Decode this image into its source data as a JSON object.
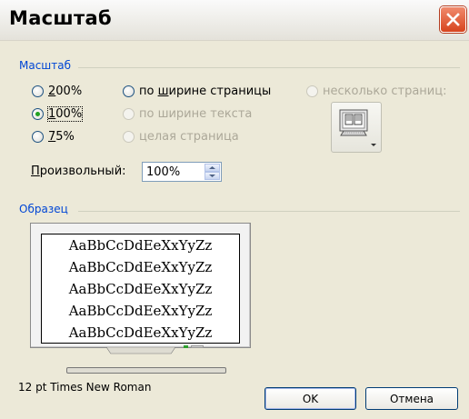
{
  "window": {
    "title": "Масштаб"
  },
  "zoom_group": {
    "label": "Масштаб",
    "options": [
      {
        "key": "200",
        "text": "200%",
        "mnemonic": "2",
        "rest": "00%",
        "checked": false,
        "disabled": false
      },
      {
        "key": "100",
        "text": "100%",
        "mnemonic": "1",
        "rest": "00%",
        "checked": true,
        "disabled": false
      },
      {
        "key": "75",
        "text": "75%",
        "mnemonic": "7",
        "rest": "5%",
        "checked": false,
        "disabled": false
      },
      {
        "key": "page_width",
        "text": "по ширине страницы",
        "pre": "по ",
        "mnemonic": "ш",
        "rest": "ирине страницы",
        "checked": false,
        "disabled": false
      },
      {
        "key": "text_width",
        "text": "по ширине текста",
        "checked": false,
        "disabled": true
      },
      {
        "key": "whole_page",
        "text": "целая страница",
        "checked": false,
        "disabled": true
      },
      {
        "key": "many_pages",
        "text": "несколько страниц:",
        "checked": false,
        "disabled": true
      }
    ],
    "custom": {
      "label_mnemonic": "П",
      "label_rest": "роизвольный:",
      "value": "100%"
    }
  },
  "sample_group": {
    "label": "Образец",
    "sample_lines": [
      "AaBbCcDdEeXxYyZz",
      "AaBbCcDdEeXxYyZz",
      "AaBbCcDdEeXxYyZz",
      "AaBbCcDdEeXxYyZz",
      "AaBbCcDdEeXxYyZz"
    ],
    "font_info": "12 pt Times New Roman"
  },
  "buttons": {
    "ok": "OK",
    "cancel": "Отмена"
  },
  "icons": {
    "close": "close-icon",
    "pages": "monitor-pages-icon",
    "spin_up": "spin-up-icon",
    "spin_down": "spin-down-icon"
  },
  "colors": {
    "group_label": "#0046d5",
    "close_button": "#d7441e",
    "dialog_bg": "#ece9d8"
  }
}
